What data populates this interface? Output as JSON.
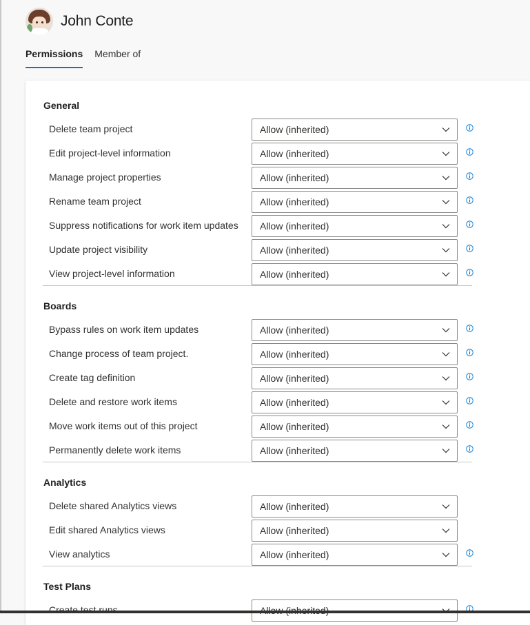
{
  "user": {
    "name": "John Conte"
  },
  "tabs": [
    {
      "label": "Permissions",
      "active": true
    },
    {
      "label": "Member of",
      "active": false
    }
  ],
  "sections": [
    {
      "title": "General",
      "rows": [
        {
          "label": "Delete team project",
          "value": "Allow (inherited)",
          "info": true
        },
        {
          "label": "Edit project-level information",
          "value": "Allow (inherited)",
          "info": true
        },
        {
          "label": "Manage project properties",
          "value": "Allow (inherited)",
          "info": true
        },
        {
          "label": "Rename team project",
          "value": "Allow (inherited)",
          "info": true
        },
        {
          "label": "Suppress notifications for work item updates",
          "value": "Allow (inherited)",
          "info": true
        },
        {
          "label": "Update project visibility",
          "value": "Allow (inherited)",
          "info": true
        },
        {
          "label": "View project-level information",
          "value": "Allow (inherited)",
          "info": true
        }
      ]
    },
    {
      "title": "Boards",
      "rows": [
        {
          "label": "Bypass rules on work item updates",
          "value": "Allow (inherited)",
          "info": true
        },
        {
          "label": "Change process of team project.",
          "value": "Allow (inherited)",
          "info": true
        },
        {
          "label": "Create tag definition",
          "value": "Allow (inherited)",
          "info": true
        },
        {
          "label": "Delete and restore work items",
          "value": "Allow (inherited)",
          "info": true
        },
        {
          "label": "Move work items out of this project",
          "value": "Allow (inherited)",
          "info": true
        },
        {
          "label": "Permanently delete work items",
          "value": "Allow (inherited)",
          "info": true
        }
      ]
    },
    {
      "title": "Analytics",
      "rows": [
        {
          "label": "Delete shared Analytics views",
          "value": "Allow (inherited)",
          "info": false
        },
        {
          "label": "Edit shared Analytics views",
          "value": "Allow (inherited)",
          "info": false
        },
        {
          "label": "View analytics",
          "value": "Allow (inherited)",
          "info": true
        }
      ]
    },
    {
      "title": "Test Plans",
      "rows": [
        {
          "label": "Create test runs",
          "value": "Allow (inherited)",
          "info": true
        }
      ]
    }
  ],
  "colors": {
    "accent": "#0078d4",
    "border": "#8a8886",
    "divider": "#c8c6c4",
    "info": "#0078d4"
  }
}
